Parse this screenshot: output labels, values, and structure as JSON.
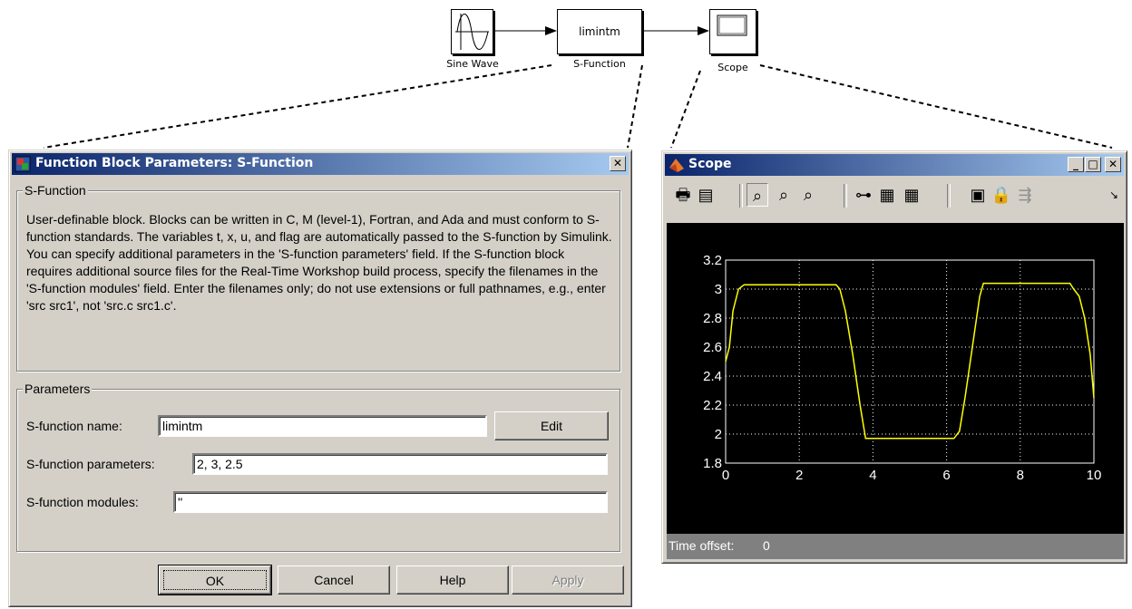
{
  "diagram": {
    "blocks": {
      "sine_label": "Sine Wave",
      "sfun_text": "limintm",
      "sfun_label": "S-Function",
      "scope_label": "Scope"
    }
  },
  "params_dialog": {
    "title": "Function Block Parameters: S-Function",
    "close_glyph": "✕",
    "section_title": "S-Function",
    "description": "User-definable block.  Blocks can be written in C, M (level-1), Fortran, and Ada and must conform to S-function standards.  The variables t, x, u, and flag are automatically passed to the S-function by Simulink.  You can specify additional parameters in the 'S-function parameters' field. If the S-function block requires additional source files for the Real-Time Workshop build process, specify the filenames in the 'S-function modules' field. Enter the filenames only; do not use extensions or full pathnames, e.g., enter 'src src1', not 'src.c src1.c'.",
    "params_title": "Parameters",
    "name_label": "S-function name:",
    "name_value": "limintm",
    "edit_button": "Edit",
    "params_label": "S-function parameters:",
    "params_value": "2, 3, 2.5",
    "modules_label": "S-function modules:",
    "modules_value": "''",
    "buttons": {
      "ok": "OK",
      "cancel": "Cancel",
      "help": "Help",
      "apply": "Apply"
    }
  },
  "scope_window": {
    "title": "Scope",
    "title_buttons": [
      "_",
      "□",
      "✕"
    ],
    "toolbar_icons": [
      "print-icon",
      "parameters-icon",
      "zoom-icon",
      "zoom-x-icon",
      "zoom-y-icon",
      "autoscale-icon",
      "save-axes-icon",
      "restore-axes-icon",
      "floating-scope-icon",
      "lock-axes-icon",
      "signal-selector-icon",
      "dock-arrow-icon"
    ],
    "time_offset_label": "Time offset:",
    "time_offset_value": "0",
    "colors": {
      "background": "#000000",
      "trace": "#ffff00",
      "grid": "#ffffff",
      "tick_text": "#ffffff"
    }
  },
  "chart_data": {
    "type": "line",
    "title": "",
    "xlabel": "",
    "ylabel": "",
    "xlim": [
      0,
      10
    ],
    "ylim": [
      1.8,
      3.2
    ],
    "xticks": [
      "0",
      "2",
      "4",
      "6",
      "8",
      "10"
    ],
    "yticks": [
      "1.8",
      "2",
      "2.2",
      "2.4",
      "2.6",
      "2.8",
      "3",
      "3.2"
    ],
    "grid": true,
    "series": [
      {
        "color": "#ffff00",
        "x": [
          0,
          0.1,
          0.2,
          0.35,
          0.5,
          0.55,
          3.0,
          3.1,
          3.25,
          3.45,
          3.65,
          3.8,
          6.2,
          6.35,
          6.5,
          6.7,
          6.9,
          7.0,
          9.35,
          9.45,
          9.6,
          9.75,
          9.9,
          10
        ],
        "y": [
          2.5,
          2.6,
          2.85,
          3.0,
          3.03,
          3.03,
          3.03,
          3.0,
          2.85,
          2.55,
          2.2,
          1.97,
          1.97,
          2.02,
          2.25,
          2.6,
          2.95,
          3.04,
          3.04,
          3.0,
          2.95,
          2.8,
          2.55,
          2.25
        ]
      }
    ]
  }
}
